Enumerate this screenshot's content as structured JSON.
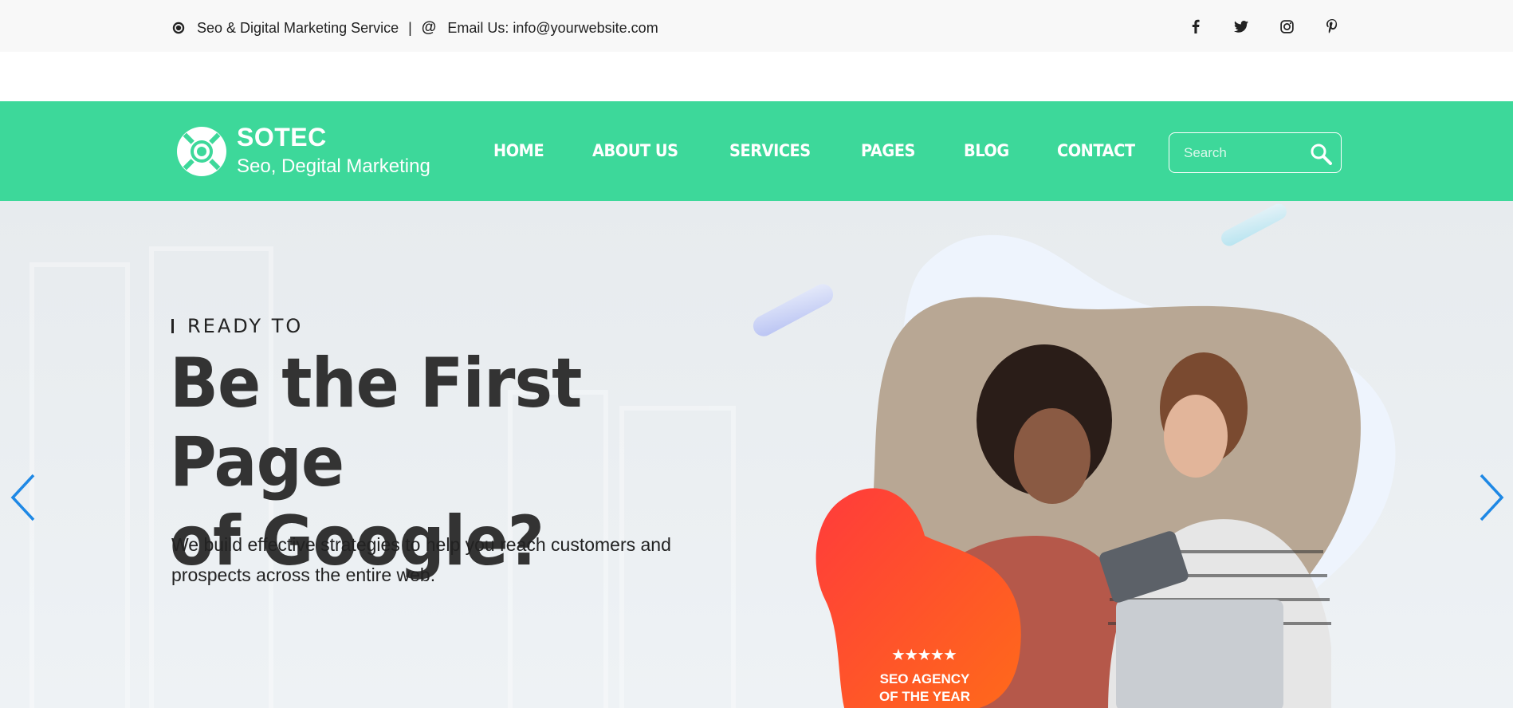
{
  "topbar": {
    "tagline": "Seo & Digital Marketing Service",
    "separator": "|",
    "at_symbol": "@",
    "email_label": "Email Us: info@yourwebsite.com",
    "icons": [
      "gear-icon",
      "facebook-icon",
      "twitter-icon",
      "instagram-icon",
      "pinterest-icon"
    ]
  },
  "brand": {
    "name": "SOTEC",
    "subtitle": "Seo, Degital Marketing",
    "color": "#3dd89a"
  },
  "nav": {
    "items": [
      "HOME",
      "ABOUT US",
      "SERVICES",
      "PAGES",
      "BLOG",
      "CONTACT"
    ]
  },
  "search": {
    "placeholder": "Search",
    "value": ""
  },
  "hero": {
    "eyebrow": "READY TO",
    "headline_line1": "Be the First Page",
    "headline_line2": "of Google?",
    "description": "We build effective strategies to help you reach customers and prospects across the entire web.",
    "badge": {
      "stars": "★★★★★",
      "line1": "SEO AGENCY",
      "line2": "OF THE YEAR",
      "colors": [
        "#ff3b3b",
        "#ff6a1a"
      ]
    },
    "arrow_color": "#1e88e5"
  }
}
